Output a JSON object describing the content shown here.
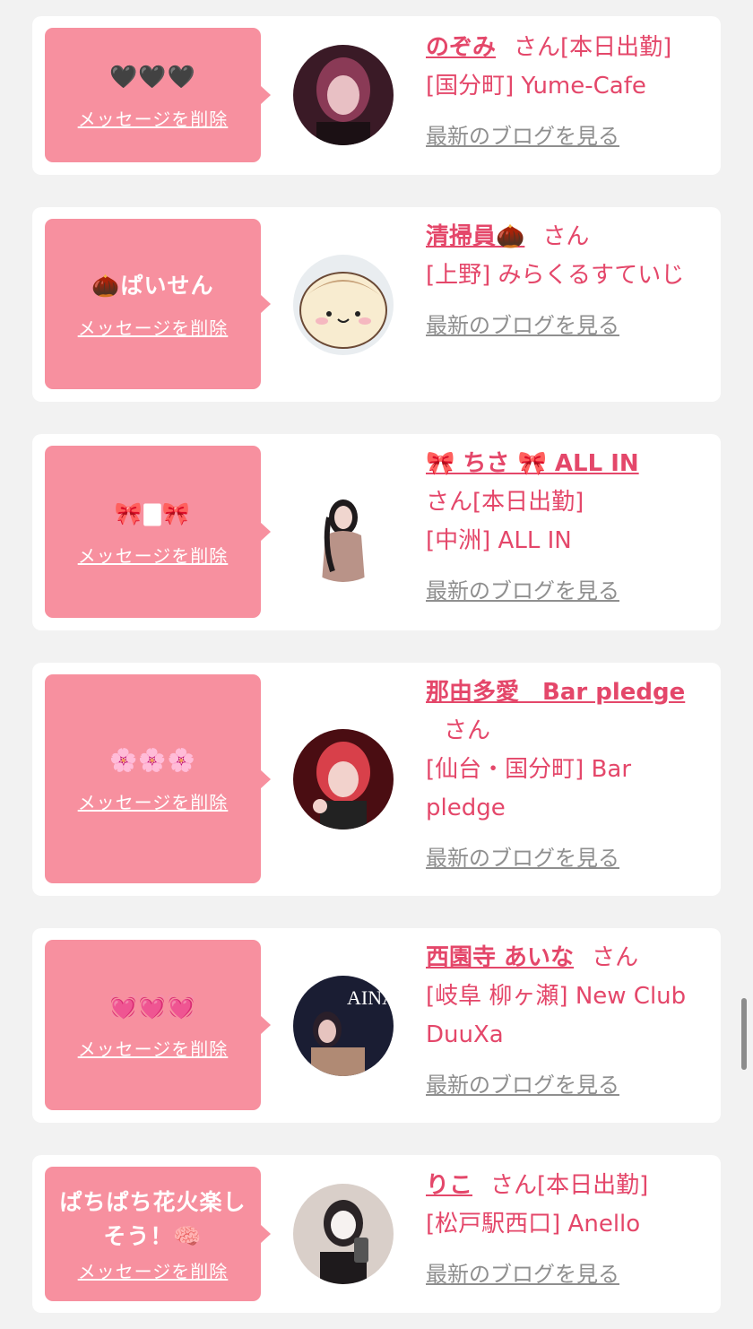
{
  "colors": {
    "accent": "#e4476a",
    "bubble": "#f7909f",
    "link_gray": "#8f8f8f"
  },
  "common": {
    "delete_label": "メッセージを削除",
    "blog_label": "最新のブログを見る",
    "san": "さん"
  },
  "cards": [
    {
      "message": "🖤🖤🖤",
      "name": "のぞみ",
      "suffix": "[本日出勤]",
      "store": "[国分町] Yume-Cafe"
    },
    {
      "message": "🌰ぱいせん",
      "name": "清掃員🌰",
      "suffix": "",
      "store": "[上野] みらくるすていじ"
    },
    {
      "message": "🎀🀫🎀",
      "name": "🎀 ちさ 🎀 ALL IN",
      "suffix": "[本日出勤]",
      "store": "[中洲] ALL IN"
    },
    {
      "message": "🌸🌸🌸",
      "name": "那由多愛　Bar pledge",
      "suffix": "",
      "store": "[仙台・国分町] Bar pledge"
    },
    {
      "message": "💓💓💓",
      "name": "西園寺 あいな",
      "suffix": "",
      "store": "[岐阜 柳ヶ瀬] New Club DuuXa"
    },
    {
      "message": "ぱちぱち花火楽しそう！🧠",
      "name": "りこ",
      "suffix": "[本日出勤]",
      "store": "[松戸駅西口] Anello"
    }
  ]
}
